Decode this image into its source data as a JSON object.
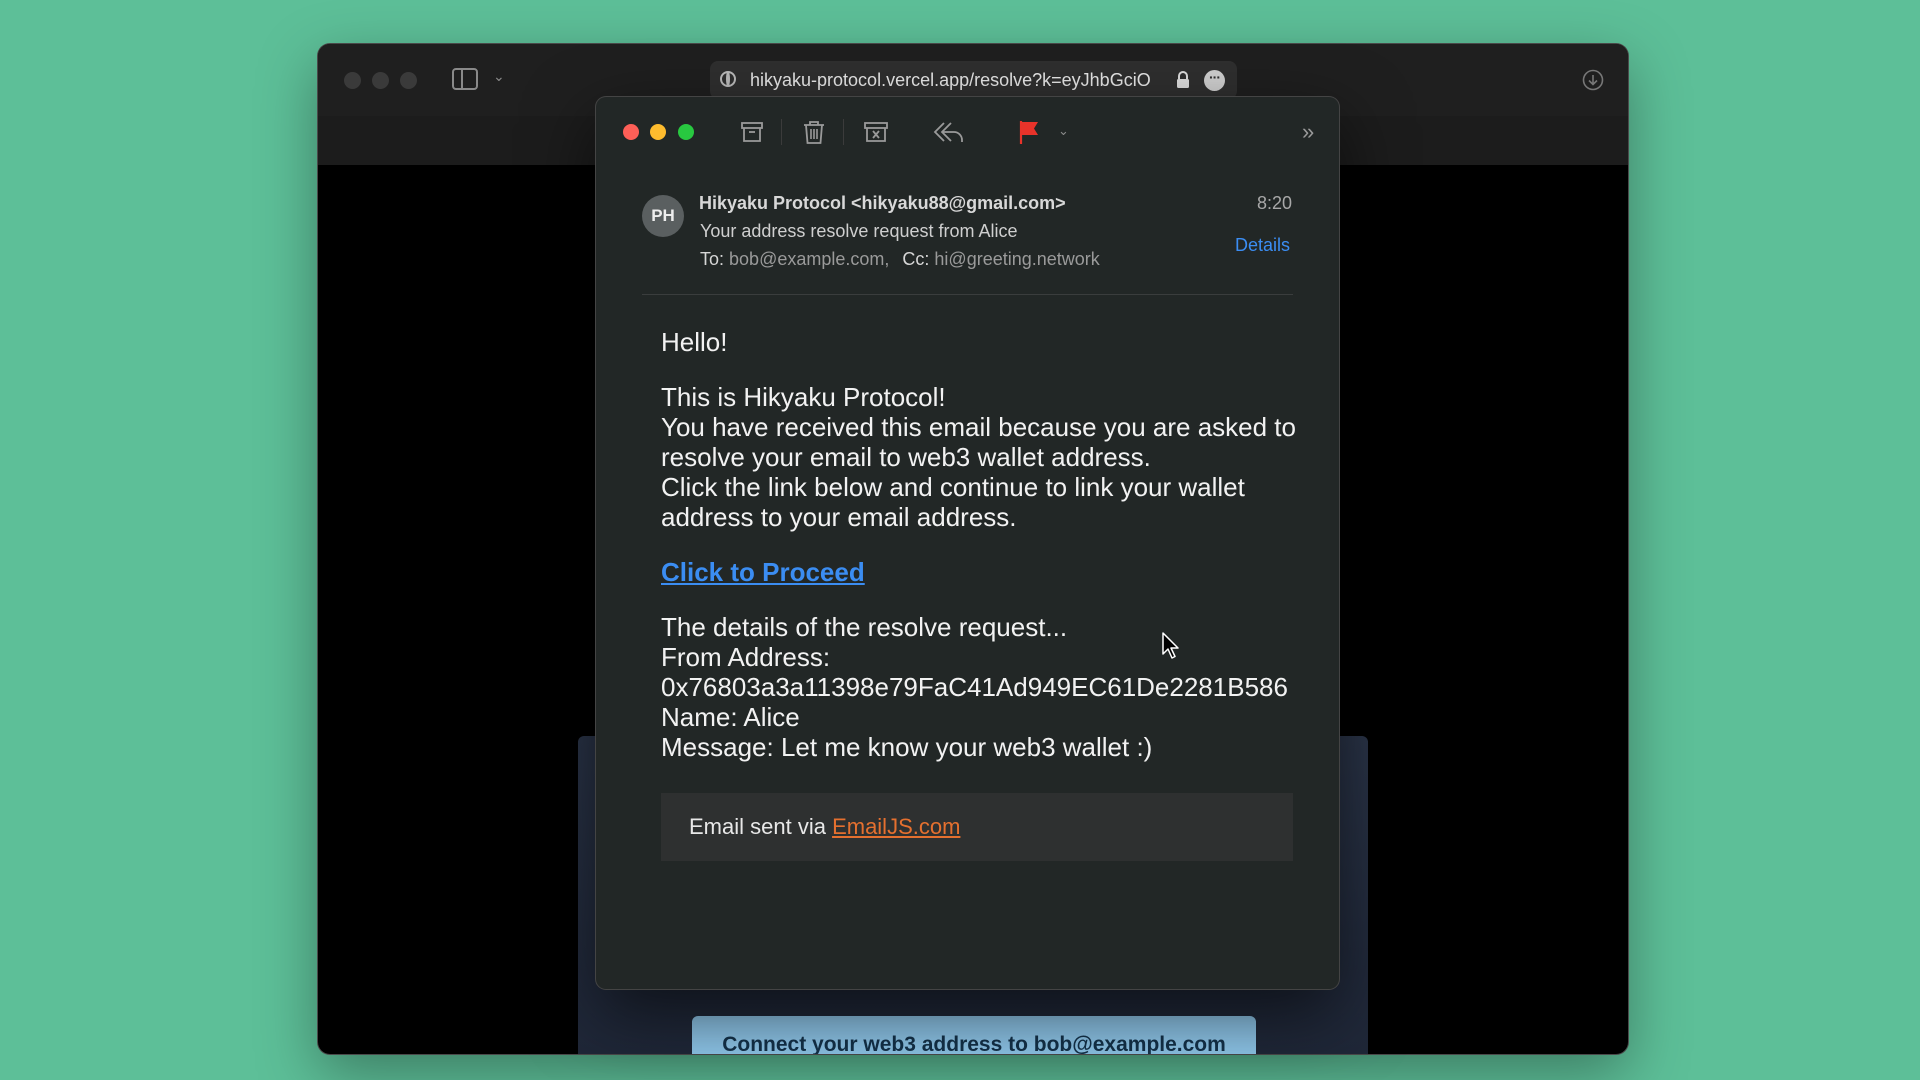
{
  "browser": {
    "url": "hikyaku-protocol.vercel.app/resolve?k=eyJhbGciO",
    "page_button_label": "Connect your web3 address to bob@example.com"
  },
  "mail": {
    "avatar_initials": "PH",
    "sender": "Hikyaku Protocol <hikyaku88@gmail.com>",
    "time": "8:20",
    "subject": "Your address resolve request from Alice",
    "to_label": "To:",
    "to_value": "bob@example.com,",
    "cc_label": "Cc:",
    "cc_value": "hi@greeting.network",
    "details_label": "Details",
    "body": {
      "greeting": "Hello!",
      "intro_line1": "This is Hikyaku Protocol!",
      "intro_line2": "You have received this email because you are asked to resolve your email to web3 wallet address.",
      "intro_line3": "Click the link below and continue to link your wallet address to your email address.",
      "proceed_link": "Click to Proceed",
      "details_heading": "The details of the resolve request...",
      "from_label": "From Address:",
      "from_address": "0x76803a3a11398e79FaC41Ad949EC61De2281B586",
      "name_line": "Name: Alice",
      "message_line": "Message: Let me know your web3 wallet :)"
    },
    "footer": {
      "prefix": "Email sent via ",
      "link": "EmailJS.com"
    }
  },
  "colors": {
    "desktop": "#5dbf98",
    "mail_bg": "#222726",
    "link_blue": "#3b8df2",
    "flag_red": "#e8332a",
    "emailjs_orange": "#e5702f"
  },
  "icons": [
    "globe-icon",
    "lock-icon",
    "more-icon",
    "sidebar-icon",
    "download-icon",
    "archive-icon",
    "trash-icon",
    "junk-icon",
    "reply-all-icon",
    "flag-icon",
    "chevron-down-icon",
    "overflow-icon",
    "cursor-icon"
  ]
}
